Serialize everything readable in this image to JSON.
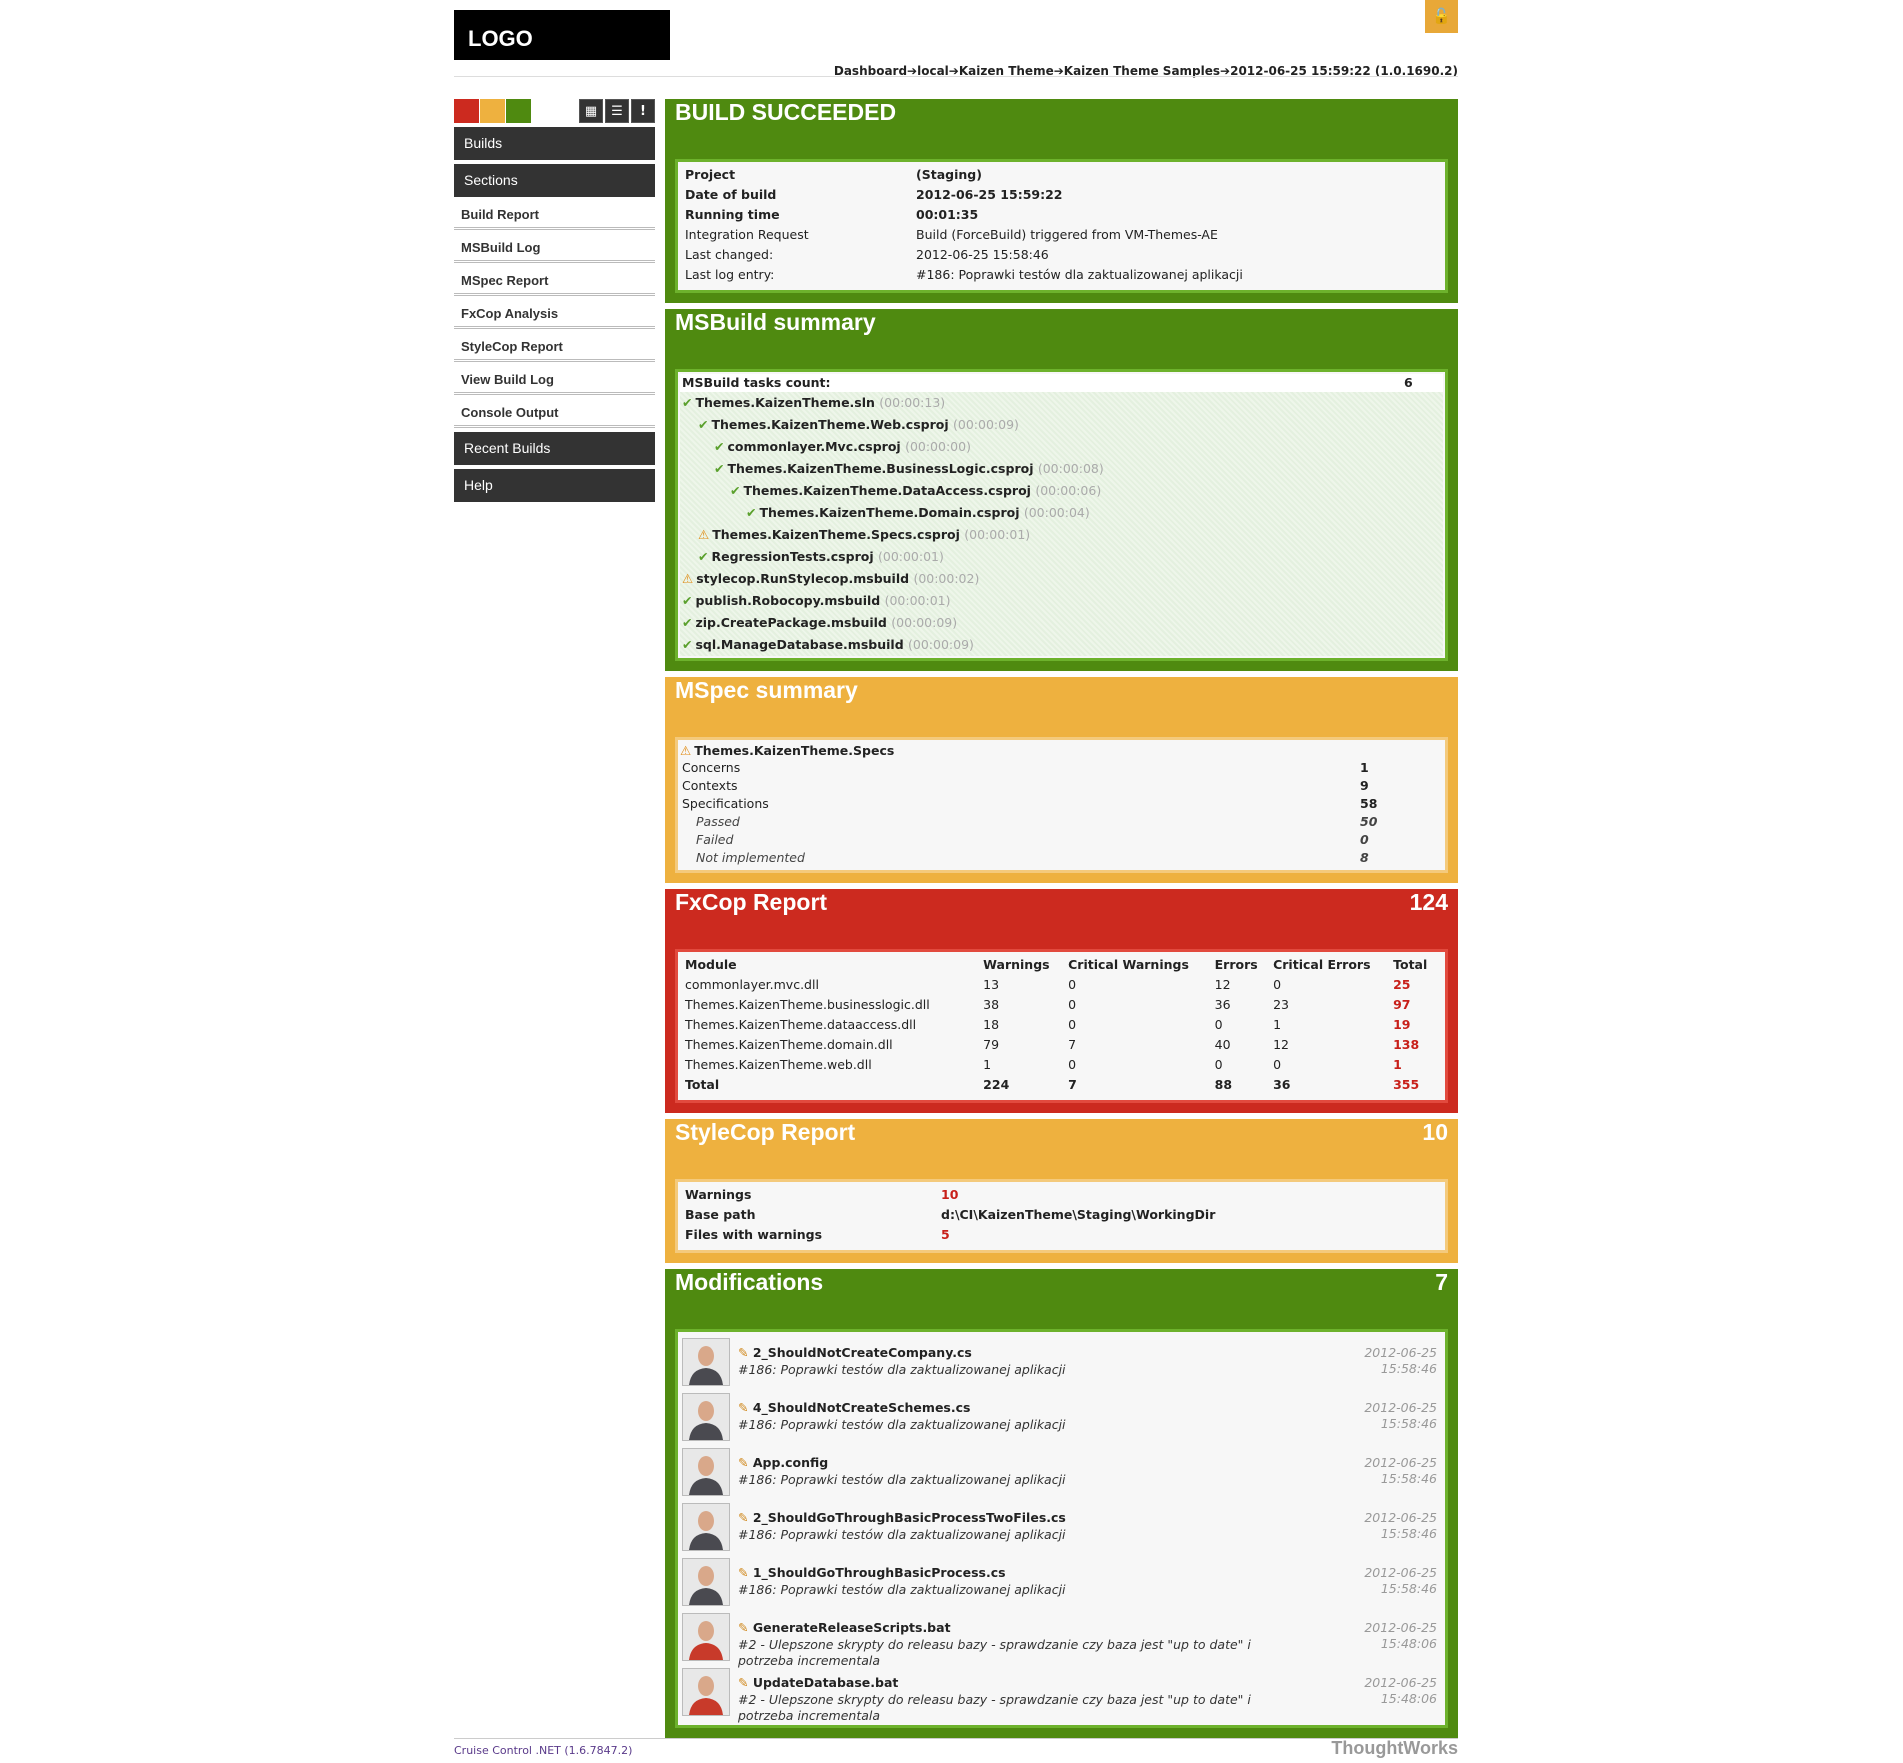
{
  "logo": "LOGO",
  "breadcrumb": "Dashboard➔local➔Kaizen Theme➔Kaizen Theme Samples➔2012-06-25 15:59:22 (1.0.1690.2)",
  "status_colors": {
    "red": "#cc2a1f",
    "orange": "#eeb13f",
    "green": "#4f8a10"
  },
  "view_buttons": [
    "grid-icon",
    "list-icon",
    "alert-icon"
  ],
  "sidebar": {
    "builds": "Builds",
    "sections": "Sections",
    "items": [
      "Build Report",
      "MSBuild Log",
      "MSpec Report",
      "FxCop Analysis",
      "StyleCop Report",
      "View Build Log",
      "Console Output"
    ],
    "recent": "Recent Builds",
    "help": "Help"
  },
  "build": {
    "title": "BUILD SUCCEEDED",
    "rows": [
      {
        "label": "Project",
        "value": "(Staging)"
      },
      {
        "label": "Date of build",
        "value": "2012-06-25 15:59:22"
      },
      {
        "label": "Running time",
        "value": "00:01:35"
      },
      {
        "label": "Integration Request",
        "value": "Build (ForceBuild) triggered from VM-Themes-AE"
      },
      {
        "label": "Last changed:",
        "value": "2012-06-25 15:58:46"
      },
      {
        "label": "Last log entry:",
        "value": "#186: Poprawki testów dla zaktualizowanej aplikacji"
      }
    ]
  },
  "msbuild": {
    "title": "MSBuild summary",
    "count_label": "MSBuild tasks count:",
    "count": "6",
    "tasks": [
      {
        "name": "Themes.KaizenTheme.sln",
        "time": "(00:00:13)",
        "status": "ok",
        "level": 0
      },
      {
        "name": "Themes.KaizenTheme.Web.csproj",
        "time": "(00:00:09)",
        "status": "ok",
        "level": 1
      },
      {
        "name": "commonlayer.Mvc.csproj",
        "time": "(00:00:00)",
        "status": "ok",
        "level": 2
      },
      {
        "name": "Themes.KaizenTheme.BusinessLogic.csproj",
        "time": "(00:00:08)",
        "status": "ok",
        "level": 2
      },
      {
        "name": "Themes.KaizenTheme.DataAccess.csproj",
        "time": "(00:00:06)",
        "status": "ok",
        "level": 3
      },
      {
        "name": "Themes.KaizenTheme.Domain.csproj",
        "time": "(00:00:04)",
        "status": "ok",
        "level": 4
      },
      {
        "name": "Themes.KaizenTheme.Specs.csproj",
        "time": "(00:00:01)",
        "status": "warn",
        "level": 1
      },
      {
        "name": "RegressionTests.csproj",
        "time": "(00:00:01)",
        "status": "ok",
        "level": 1
      },
      {
        "name": "stylecop.RunStylecop.msbuild",
        "time": "(00:00:02)",
        "status": "warn",
        "level": 0
      },
      {
        "name": "publish.Robocopy.msbuild",
        "time": "(00:00:01)",
        "status": "ok",
        "level": 0
      },
      {
        "name": "zip.CreatePackage.msbuild",
        "time": "(00:00:09)",
        "status": "ok",
        "level": 0
      },
      {
        "name": "sql.ManageDatabase.msbuild",
        "time": "(00:00:09)",
        "status": "ok",
        "level": 0
      }
    ]
  },
  "mspec": {
    "title": "MSpec summary",
    "assembly": "Themes.KaizenTheme.Specs",
    "rows": [
      {
        "label": "Concerns",
        "value": "1",
        "italic": false
      },
      {
        "label": "Contexts",
        "value": "9",
        "italic": false
      },
      {
        "label": "Specifications",
        "value": "58",
        "italic": false
      },
      {
        "label": "Passed",
        "value": "50",
        "italic": true
      },
      {
        "label": "Failed",
        "value": "0",
        "italic": true
      },
      {
        "label": "Not implemented",
        "value": "8",
        "italic": true
      }
    ]
  },
  "fxcop": {
    "title": "FxCop Report",
    "count": "124",
    "headers": [
      "Module",
      "Warnings",
      "Critical Warnings",
      "Errors",
      "Critical Errors",
      "Total"
    ],
    "rows": [
      [
        "commonlayer.mvc.dll",
        "13",
        "0",
        "12",
        "0",
        "25"
      ],
      [
        "Themes.KaizenTheme.businesslogic.dll",
        "38",
        "0",
        "36",
        "23",
        "97"
      ],
      [
        "Themes.KaizenTheme.dataaccess.dll",
        "18",
        "0",
        "0",
        "1",
        "19"
      ],
      [
        "Themes.KaizenTheme.domain.dll",
        "79",
        "7",
        "40",
        "12",
        "138"
      ],
      [
        "Themes.KaizenTheme.web.dll",
        "1",
        "0",
        "0",
        "0",
        "1"
      ]
    ],
    "total": [
      "Total",
      "224",
      "7",
      "88",
      "36",
      "355"
    ]
  },
  "stylecop": {
    "title": "StyleCop Report",
    "count": "10",
    "rows": [
      {
        "label": "Warnings",
        "value": "10",
        "red": true
      },
      {
        "label": "Base path",
        "value": "d:\\CI\\KaizenTheme\\Staging\\WorkingDir",
        "red": false
      },
      {
        "label": "Files with warnings",
        "value": "5",
        "red": true
      }
    ]
  },
  "modifications": {
    "title": "Modifications",
    "count": "7",
    "items": [
      {
        "file": "2_ShouldNotCreateCompany.cs",
        "comment": "#186: Poprawki testów dla zaktualizowanej aplikacji",
        "date": "2012-06-25",
        "time": "15:58:46",
        "avatar": "user-a"
      },
      {
        "file": "4_ShouldNotCreateSchemes.cs",
        "comment": "#186: Poprawki testów dla zaktualizowanej aplikacji",
        "date": "2012-06-25",
        "time": "15:58:46",
        "avatar": "user-a"
      },
      {
        "file": "App.config",
        "comment": "#186: Poprawki testów dla zaktualizowanej aplikacji",
        "date": "2012-06-25",
        "time": "15:58:46",
        "avatar": "user-a"
      },
      {
        "file": "2_ShouldGoThroughBasicProcessTwoFiles.cs",
        "comment": "#186: Poprawki testów dla zaktualizowanej aplikacji",
        "date": "2012-06-25",
        "time": "15:58:46",
        "avatar": "user-a"
      },
      {
        "file": "1_ShouldGoThroughBasicProcess.cs",
        "comment": "#186: Poprawki testów dla zaktualizowanej aplikacji",
        "date": "2012-06-25",
        "time": "15:58:46",
        "avatar": "user-a"
      },
      {
        "file": "GenerateReleaseScripts.bat",
        "comment": "#2 - Ulepszone skrypty do releasu bazy - sprawdzanie czy baza jest \"up to date\" i potrzeba incrementala",
        "date": "2012-06-25",
        "time": "15:48:06",
        "avatar": "user-b"
      },
      {
        "file": "UpdateDatabase.bat",
        "comment": "#2 - Ulepszone skrypty do releasu bazy - sprawdzanie czy baza jest \"up to date\" i potrzeba incrementala",
        "date": "2012-06-25",
        "time": "15:48:06",
        "avatar": "user-b"
      }
    ]
  },
  "footer": {
    "left": "Cruise Control .NET (1.6.7847.2)",
    "right": "ThoughtWorks"
  }
}
